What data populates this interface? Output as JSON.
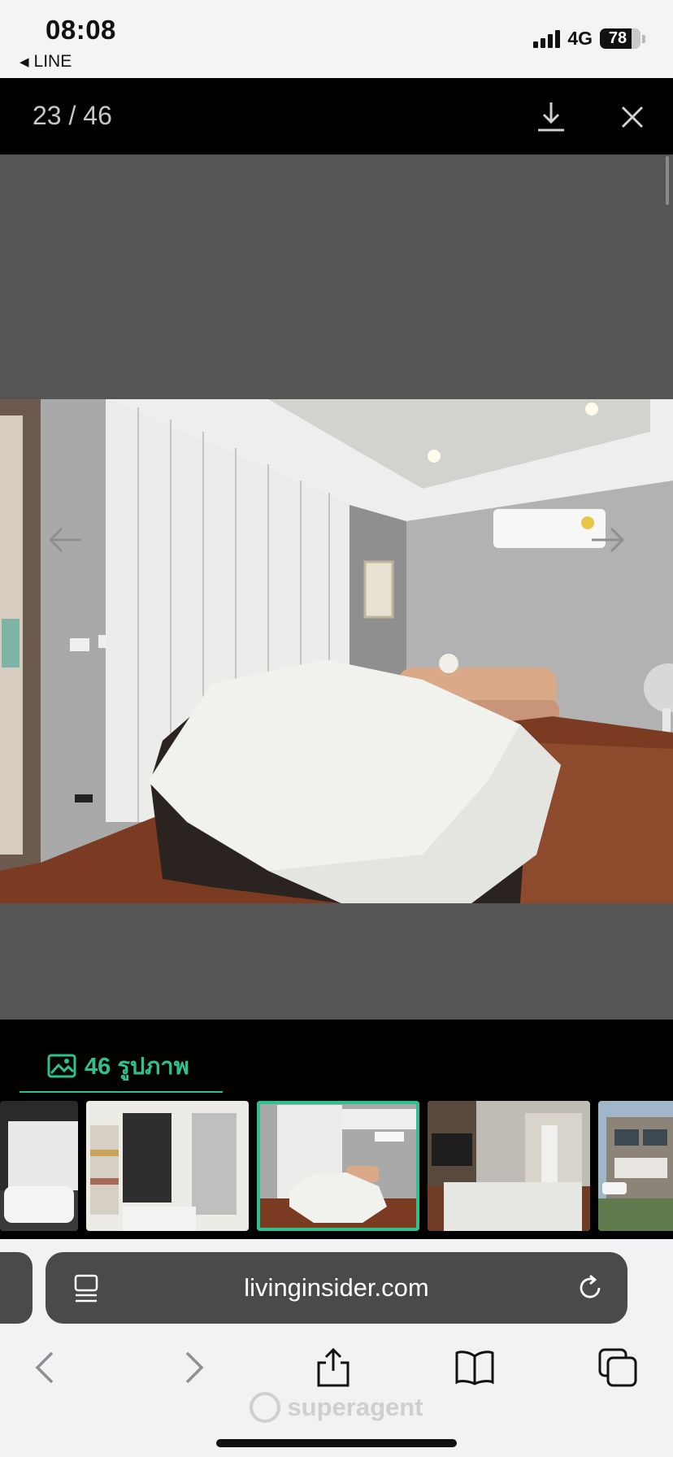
{
  "status_bar": {
    "time": "08:08",
    "back_app": "LINE",
    "network": "4G",
    "battery": "78"
  },
  "gallery": {
    "counter": "23 / 46",
    "photos_tab_label": "46 รูปภาพ",
    "thumbnails": [
      {
        "name": "bathroom",
        "active": false
      },
      {
        "name": "walk-in-closet",
        "active": false
      },
      {
        "name": "bedroom",
        "active": true
      },
      {
        "name": "living-room",
        "active": false
      },
      {
        "name": "house-exterior",
        "active": false
      }
    ]
  },
  "browser": {
    "url": "livinginsider.com"
  },
  "watermark": "superagent",
  "icons": [
    "download-icon",
    "close-icon",
    "prev-arrow-icon",
    "next-arrow-icon",
    "image-icon",
    "reader-icon",
    "reload-icon",
    "back-icon",
    "forward-icon",
    "share-icon",
    "bookmarks-icon",
    "tabs-icon"
  ],
  "colors": {
    "accent": "#2fc08f",
    "header_bg": "#000000",
    "stage_bg": "#555556",
    "urlbar_bg": "#4a4a4c"
  }
}
